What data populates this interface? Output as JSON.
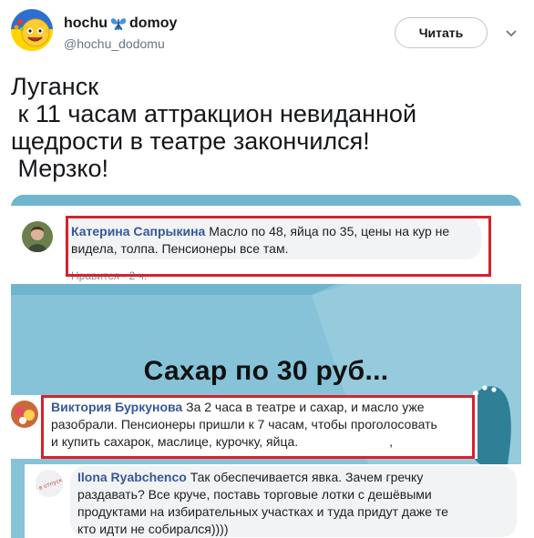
{
  "header": {
    "display_name_part1": "hochu",
    "display_name_part2": "domoy",
    "handle": "@hochu_dodomu",
    "follow_label": "Читать"
  },
  "tweet": {
    "text": "Луганск\n к 11 часам аттракцион невиданной\nщедрости в театре закончился!\n Мерзко!"
  },
  "media": {
    "caption": "Сахар по 30 руб...",
    "comments": [
      {
        "author": "Катерина Сапрыкина",
        "line1_rest": " Масло по 48, яйца по 35, цены на кур не",
        "line2": "видела, толпа. Пенсионеры все там.",
        "meta": "Нравится · 2 ч."
      },
      {
        "author": "Виктория Буркунова",
        "line1_rest": " За 2 часа в театре и сахар, и масло уже",
        "line2": "разобрали. Пенсионеры пришли к 7 часам, чтобы проголосовать",
        "line3": "и купить сахарок, маслице, курочку, яйца.",
        "line3_tail": ","
      },
      {
        "author": "Ilona Ryabchenco",
        "line1_rest": " Так обеспечивается явка. Зачем гречку",
        "line2": "раздавать? Все круче, поставь торговые лотки с дешёвыми",
        "line3": "продуктами на избирательных участках и туда придут даже те",
        "line4": "кто идти не собирался))))",
        "avatar_text": "Я в отпуске"
      }
    ]
  },
  "colors": {
    "accent_red": "#d4232c",
    "fb_link": "#365899",
    "media_blue": "#70b3cb"
  }
}
